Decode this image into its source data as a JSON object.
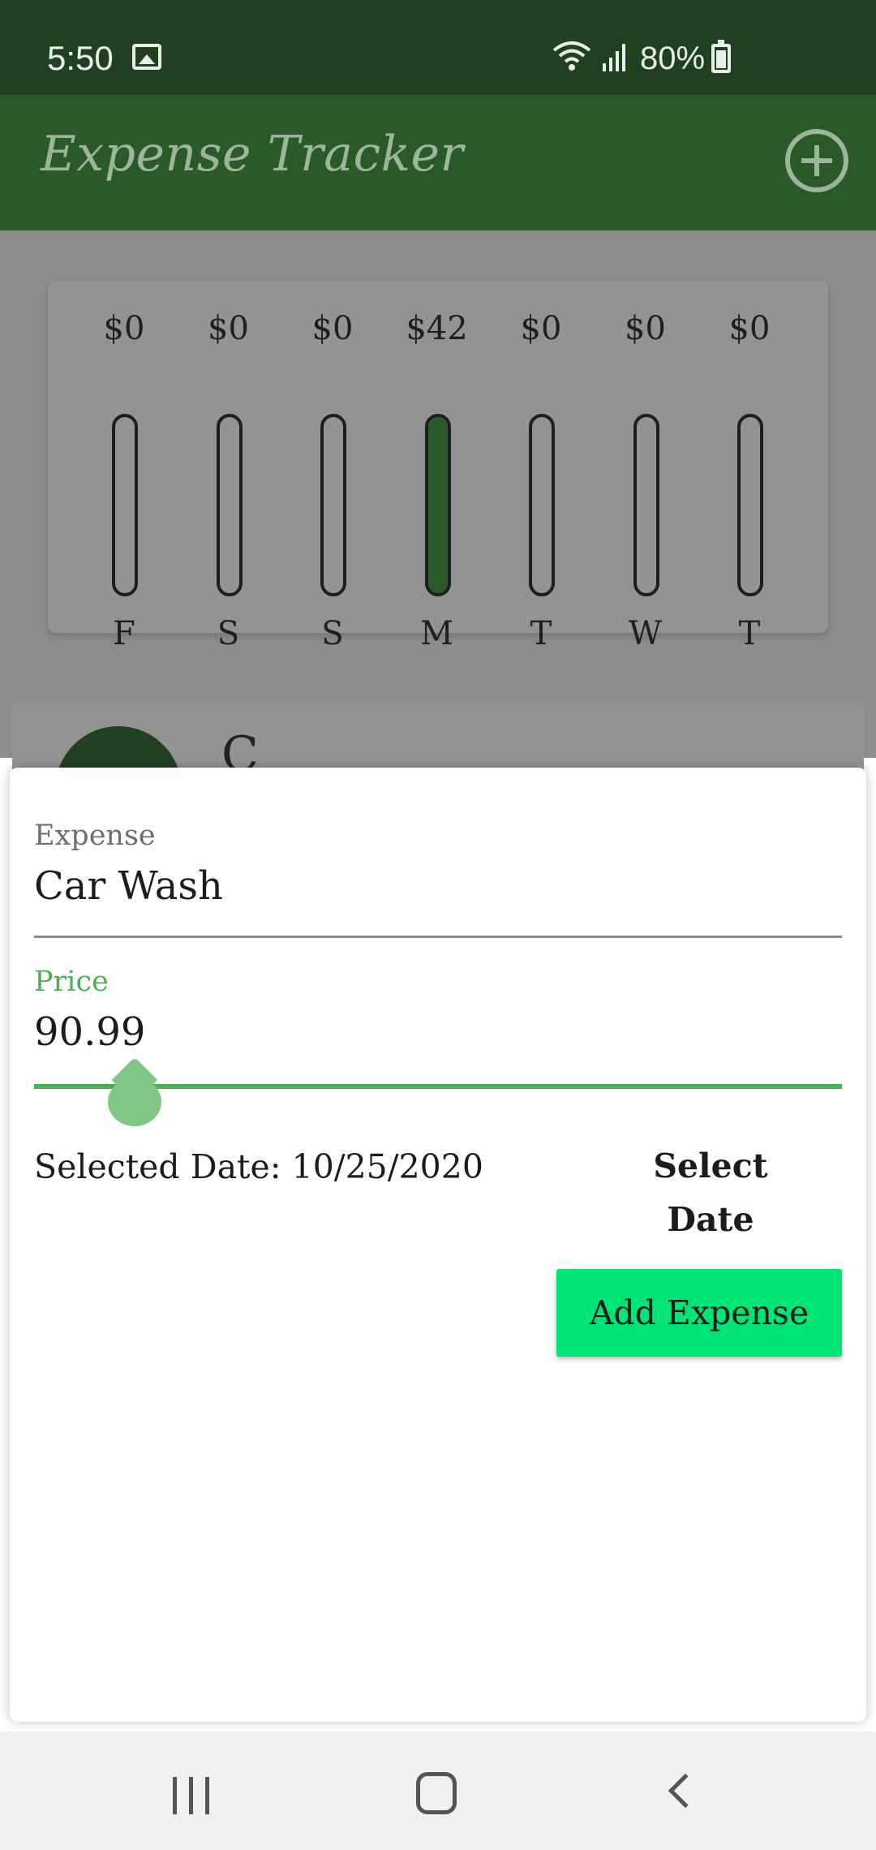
{
  "status_bar": {
    "time": "5:50",
    "battery": "80%",
    "icons": [
      "image-icon",
      "wifi-icon",
      "signal-icon",
      "battery-charging-icon"
    ]
  },
  "app_bar": {
    "title": "Expense Tracker",
    "add_icon": "add-circle-icon"
  },
  "chart_data": {
    "type": "bar",
    "categories": [
      "F",
      "S",
      "S",
      "M",
      "T",
      "W",
      "T"
    ],
    "labels": [
      "$0",
      "$0",
      "$0",
      "$42",
      "$0",
      "$0",
      "$0"
    ],
    "values": [
      0,
      0,
      0,
      42,
      0,
      0,
      0
    ],
    "fill_fraction": [
      0,
      0,
      0,
      1,
      0,
      0,
      0
    ],
    "title": "",
    "xlabel": "",
    "ylabel": ""
  },
  "list_preview": {
    "title_fragment": "C"
  },
  "sheet": {
    "expense_label": "Expense",
    "expense_value": "Car Wash",
    "price_label": "Price",
    "price_value": "90.99",
    "slider_fraction": 0.124,
    "selected_date": "Selected Date: 10/25/2020",
    "select_date_label": "Select Date",
    "add_expense_label": "Add Expense"
  },
  "colors": {
    "status_bar": "#20401f",
    "app_bar": "#2a5a2a",
    "accent": "#4caf50",
    "button": "#00e676"
  },
  "nav_bar": {
    "icons": [
      "recents-icon",
      "home-icon",
      "back-icon"
    ]
  }
}
